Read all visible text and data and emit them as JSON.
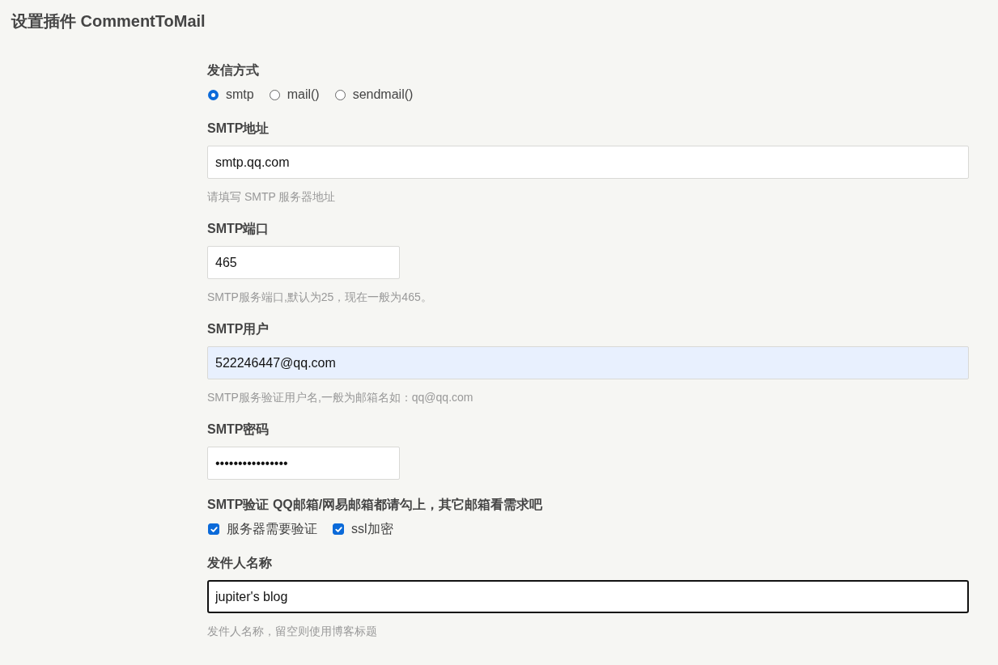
{
  "page_title": "设置插件 CommentToMail",
  "fields": [
    {
      "kind": "radio",
      "label": "发信方式",
      "options": [
        {
          "label": "smtp",
          "selected": true
        },
        {
          "label": "mail()",
          "selected": false
        },
        {
          "label": "sendmail()",
          "selected": false
        }
      ]
    },
    {
      "kind": "text",
      "label": "SMTP地址",
      "value": "smtp.qq.com",
      "autofilled": false,
      "focused": false,
      "hint": "请填写 SMTP 服务器地址"
    },
    {
      "kind": "number",
      "label": "SMTP端口",
      "value": "465",
      "autofilled": false,
      "focused": false,
      "hint": "SMTP服务端口,默认为25，现在一般为465。"
    },
    {
      "kind": "text",
      "label": "SMTP用户",
      "value": "522246447@qq.com",
      "autofilled": true,
      "focused": false,
      "hint": "SMTP服务验证用户名,一般为邮箱名如：qq@qq.com"
    },
    {
      "kind": "password",
      "label": "SMTP密码",
      "value": "••••••••••••••••",
      "autofilled": false,
      "focused": false
    },
    {
      "kind": "checkbox",
      "label": "SMTP验证 QQ邮箱/网易邮箱都请勾上，其它邮箱看需求吧",
      "options": [
        {
          "label": "服务器需要验证",
          "checked": true
        },
        {
          "label": "ssl加密",
          "checked": true
        }
      ]
    },
    {
      "kind": "text",
      "label": "发件人名称",
      "value": "jupiter's blog",
      "autofilled": false,
      "focused": true,
      "hint": "发件人名称，留空则使用博客标题"
    }
  ]
}
